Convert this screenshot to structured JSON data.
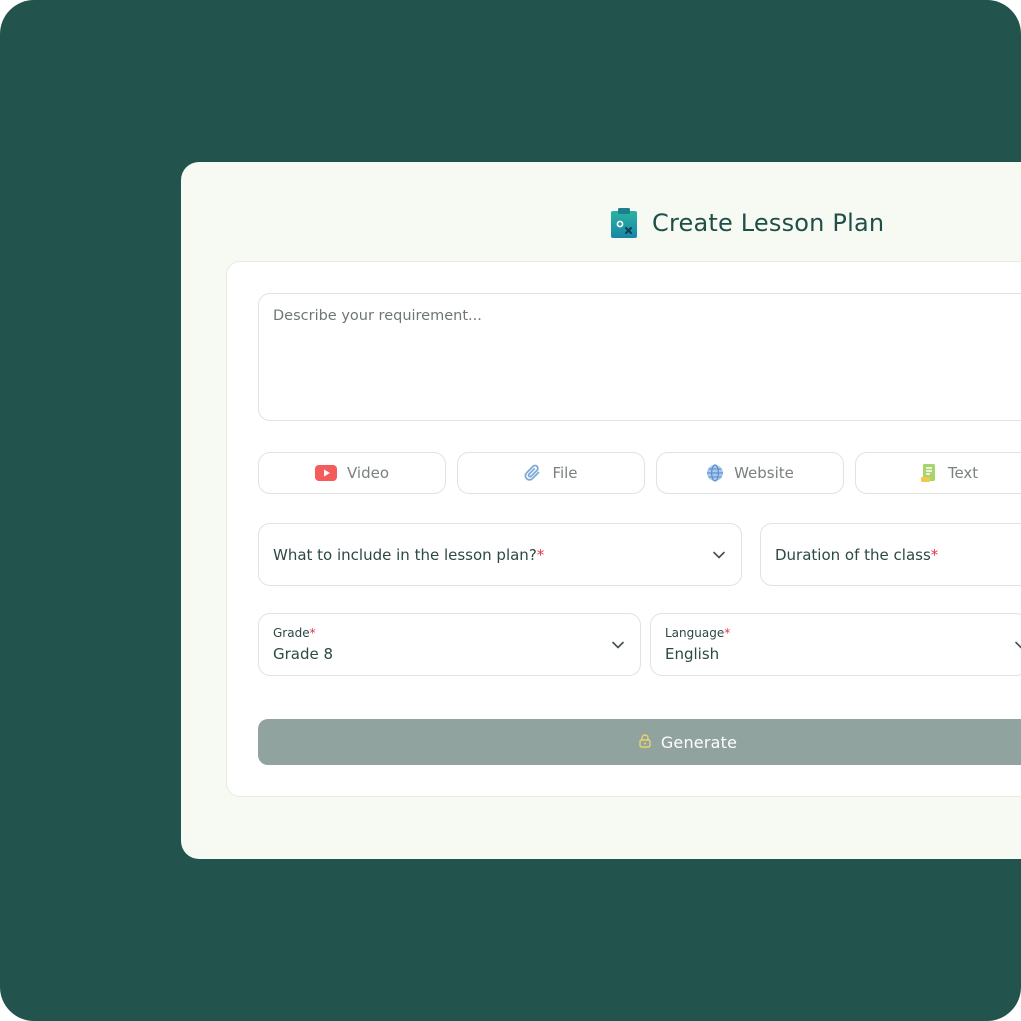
{
  "header": {
    "title": "Create Lesson Plan",
    "icon": "clipboard-icon"
  },
  "requirement": {
    "placeholder": "Describe your requirement..."
  },
  "sources": [
    {
      "label": "Video",
      "icon": "youtube-icon"
    },
    {
      "label": "File",
      "icon": "paperclip-icon"
    },
    {
      "label": "Website",
      "icon": "globe-icon"
    },
    {
      "label": "Text",
      "icon": "document-text-icon"
    }
  ],
  "include_field": {
    "label": "What to include in the lesson plan?",
    "required_mark": "*"
  },
  "duration_field": {
    "label": "Duration of the class",
    "required_mark": "*"
  },
  "grade_field": {
    "label": "Grade",
    "required_mark": "*",
    "value": "Grade 8"
  },
  "language_field": {
    "label": "Language",
    "required_mark": "*",
    "value": "English"
  },
  "generate": {
    "label": "Generate",
    "icon": "lock-icon"
  },
  "colors": {
    "background": "#22544d",
    "panel": "#f7f9f3",
    "accent": "#1f4f49",
    "required": "#e0344f",
    "button_disabled": "#90a39e"
  }
}
